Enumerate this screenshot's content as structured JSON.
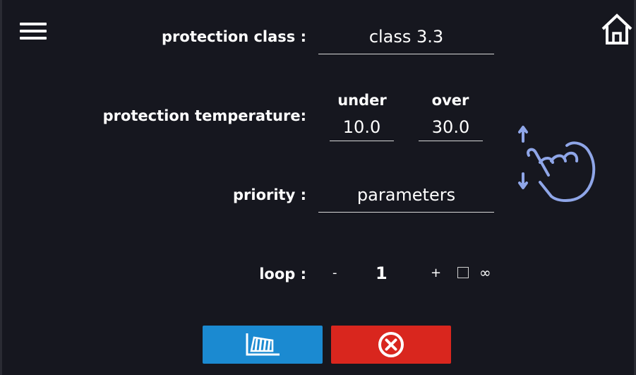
{
  "header": {
    "menu_icon": "hamburger-menu-icon",
    "home_icon": "home-icon"
  },
  "protection_class": {
    "label": "protection class :",
    "value": "class 3.3"
  },
  "protection_temperature": {
    "label": "protection temperature:",
    "under_label": "under",
    "under_value": "10.0",
    "over_label": "over",
    "over_value": "30.0"
  },
  "priority": {
    "label": "priority :",
    "value": "parameters"
  },
  "loop": {
    "label": "loop :",
    "minus": "-",
    "value": "1",
    "plus": "+",
    "infinite_checked": false,
    "infinite_symbol": "∞"
  },
  "gesture_hint": {
    "icon": "swipe-up-down-hand-icon"
  },
  "buttons": {
    "chart_icon": "chart-profile-icon",
    "cancel_icon": "cancel-circle-icon"
  },
  "colors": {
    "background": "#16171f",
    "chart_button": "#1b8ad1",
    "cancel_button": "#d9261e",
    "gesture_accent": "#8fa6e8"
  }
}
